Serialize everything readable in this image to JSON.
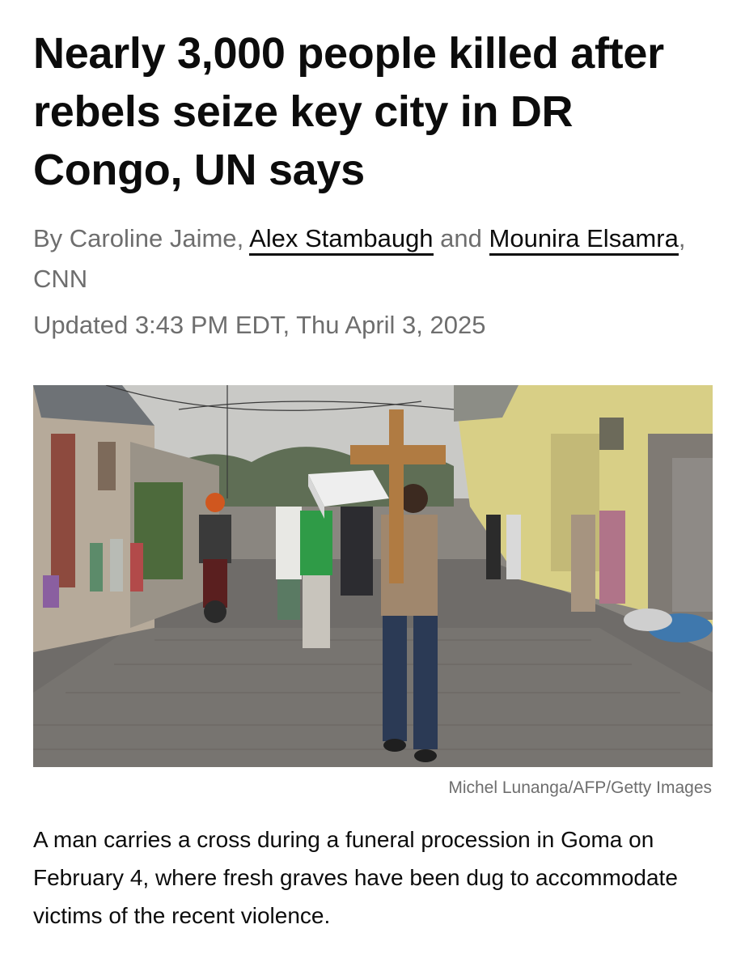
{
  "headline": "Nearly 3,000 people killed after rebels seize key city in DR Congo, UN says",
  "byline": {
    "prefix": "By ",
    "author_1": "Caroline Jaime",
    "sep_1": ", ",
    "author_2": "Alex Stambaugh",
    "sep_2": " and ",
    "author_3": "Mounira Elsamra",
    "suffix": ", CNN"
  },
  "timestamp": "Updated 3:43 PM EDT, Thu April 3, 2025",
  "photo": {
    "credit": "Michel Lunanga/AFP/Getty Images"
  },
  "caption": "A man carries a cross during a funeral procession in Goma on February 4, where fresh graves have been dug to accommodate victims of the recent violence.",
  "colors": {
    "text": "#0c0c0c",
    "muted": "#6e6e6e",
    "background": "#ffffff"
  }
}
